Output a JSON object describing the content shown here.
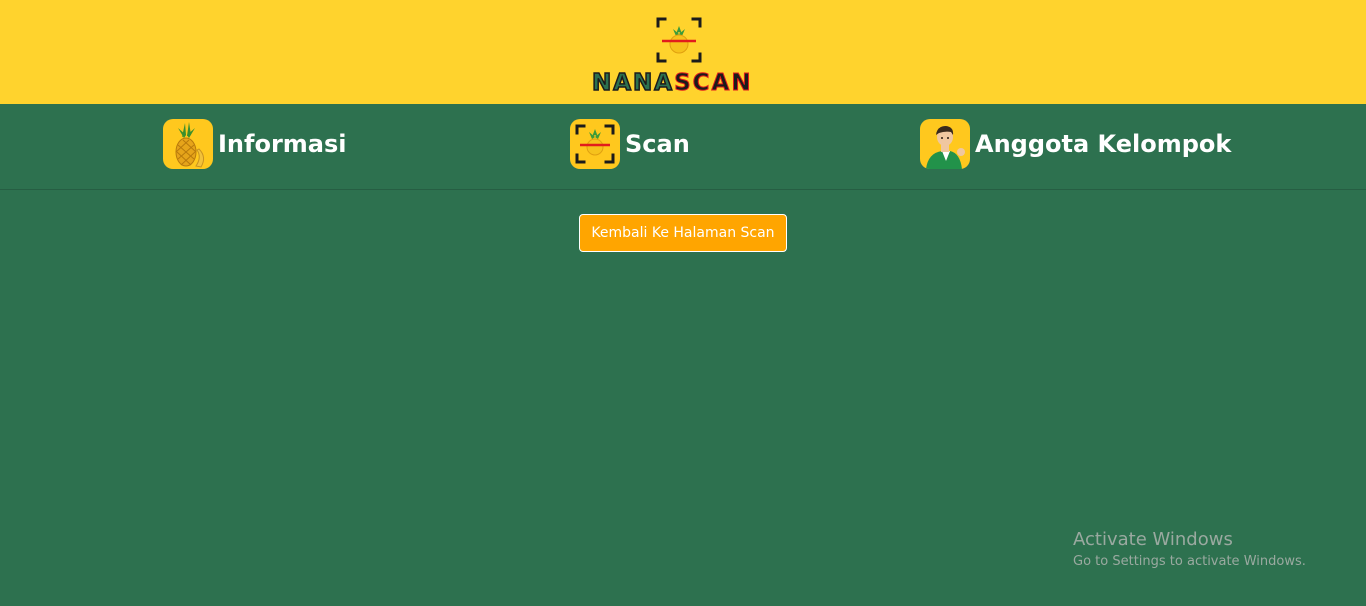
{
  "header": {
    "logo_part1": "NANA",
    "logo_part2": "SCAN",
    "logo_icon": "pineapple-scan-frame-icon"
  },
  "nav": {
    "items": [
      {
        "label": "Informasi",
        "icon": "pineapple-icon"
      },
      {
        "label": "Scan",
        "icon": "scan-frame-icon"
      },
      {
        "label": "Anggota Kelompok",
        "icon": "person-icon"
      }
    ]
  },
  "main": {
    "back_button_label": "Kembali Ke Halaman Scan"
  },
  "watermark": {
    "title": "Activate Windows",
    "subtitle": "Go to Settings to activate Windows."
  },
  "colors": {
    "header_bg": "#ffd32d",
    "page_bg": "#2d714f",
    "button_bg": "#ffa500",
    "icon_bg": "#ffc81e"
  }
}
